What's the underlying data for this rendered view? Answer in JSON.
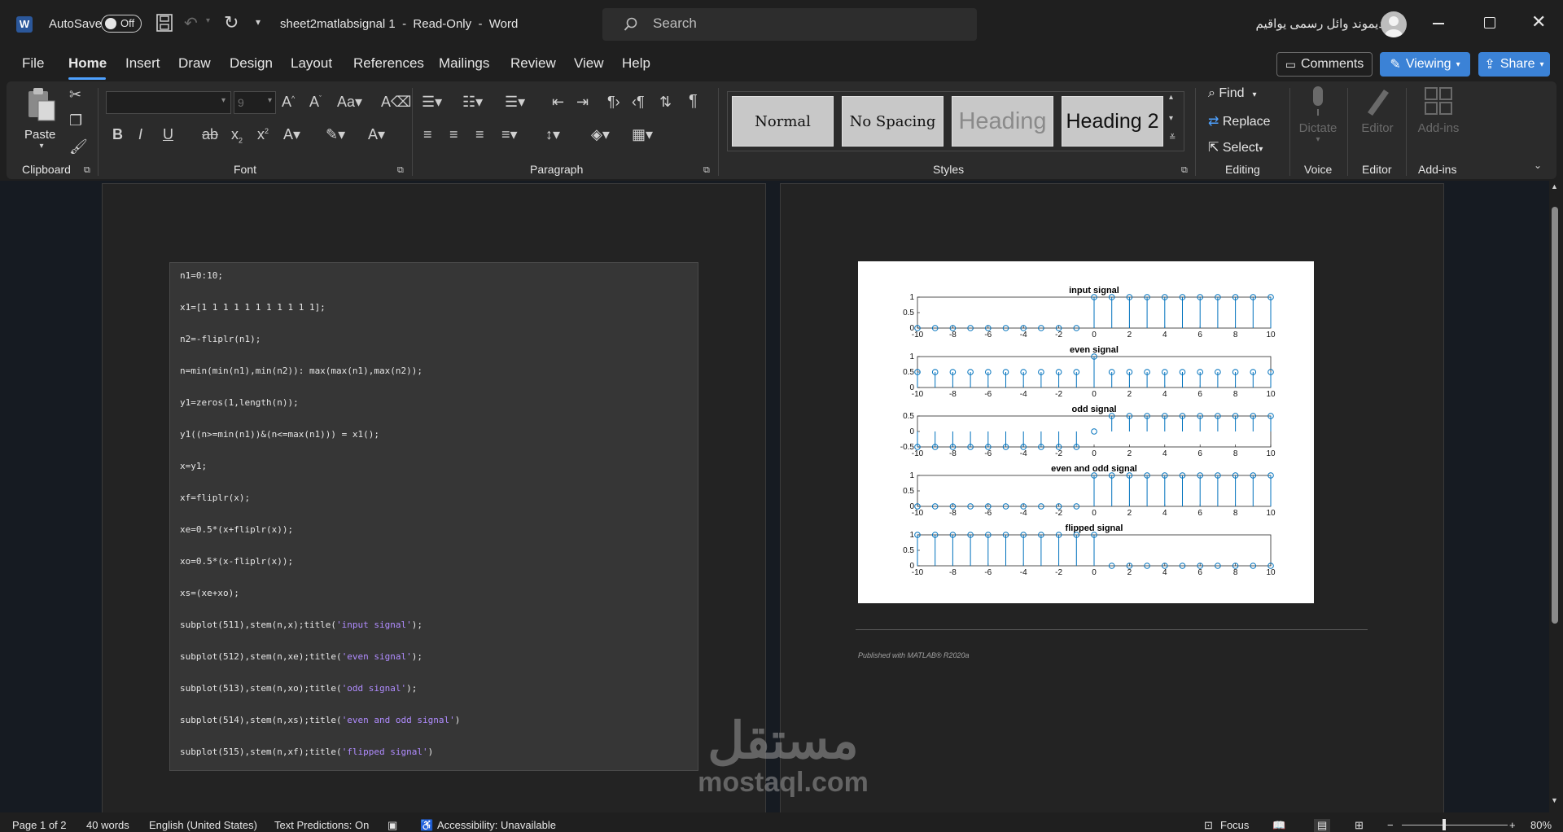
{
  "titlebar": {
    "autosave_label": "AutoSave",
    "autosave_state": "Off",
    "doc_title": "sheet2matlabsignal 1  -  Read-Only  -  Word",
    "search_placeholder": "Search",
    "user_name": "ديموند وائل رسمى يواقيم"
  },
  "menu": {
    "items": [
      "File",
      "Home",
      "Insert",
      "Draw",
      "Design",
      "Layout",
      "References",
      "Mailings",
      "Review",
      "View",
      "Help"
    ],
    "active": "Home",
    "comments_label": "Comments",
    "viewing_label": "Viewing",
    "share_label": "Share"
  },
  "ribbon": {
    "clipboard": {
      "paste_label": "Paste",
      "group_label": "Clipboard"
    },
    "font": {
      "font_name": "",
      "font_size": "9",
      "group_label": "Font"
    },
    "paragraph": {
      "group_label": "Paragraph"
    },
    "styles": {
      "group_label": "Styles",
      "items": [
        "Normal",
        "No Spacing",
        "Heading",
        "Heading 2"
      ]
    },
    "editing": {
      "find_label": "Find",
      "replace_label": "Replace",
      "select_label": "Select",
      "group_label": "Editing"
    },
    "voice": {
      "dictate_label": "Dictate",
      "group_label": "Voice"
    },
    "editor": {
      "editor_label": "Editor",
      "group_label": "Editor"
    },
    "addins": {
      "addins_label": "Add-ins",
      "group_label": "Add-ins"
    }
  },
  "document": {
    "code_lines": [
      [
        {
          "t": "n1=0:10;"
        }
      ],
      [
        {
          "t": "x1=[1 1 1 1 1 1 1 1 1 1 1];"
        }
      ],
      [
        {
          "t": "n2=-fliplr(n1);"
        }
      ],
      [
        {
          "t": "n=min(min(n1),min(n2)): max(max(n1),max(n2));"
        }
      ],
      [
        {
          "t": "y1=zeros(1,length(n));"
        }
      ],
      [
        {
          "t": "y1((n>=min(n1))&(n<=max(n1))) = x1();"
        }
      ],
      [
        {
          "t": "x=y1;"
        }
      ],
      [
        {
          "t": "xf=fliplr(x);"
        }
      ],
      [
        {
          "t": "xe=0.5*(x+fliplr(x));"
        }
      ],
      [
        {
          "t": "xo=0.5*(x-fliplr(x));"
        }
      ],
      [
        {
          "t": "xs=(xe+xo);"
        }
      ],
      [
        {
          "t": "subplot(511),stem(n,x);title("
        },
        {
          "t": "'input signal'",
          "s": true
        },
        {
          "t": ");"
        }
      ],
      [
        {
          "t": "subplot(512),stem(n,xe);title("
        },
        {
          "t": "'even signal'",
          "s": true
        },
        {
          "t": ");"
        }
      ],
      [
        {
          "t": "subplot(513),stem(n,xo);title("
        },
        {
          "t": "'odd signal'",
          "s": true
        },
        {
          "t": ");"
        }
      ],
      [
        {
          "t": "subplot(514),stem(n,xs);title("
        },
        {
          "t": "'even and odd signal'",
          "s": true
        },
        {
          "t": ")"
        }
      ],
      [
        {
          "t": "subplot(515),stem(n,xf);title("
        },
        {
          "t": "'flipped signal'",
          "s": true
        },
        {
          "t": ")"
        }
      ]
    ],
    "published_note": "Published with MATLAB® R2020a",
    "watermark_text": "mostaql.com",
    "watermark_arabic": "مستقل"
  },
  "chart_data": {
    "type": "scatter",
    "subtype": "stem",
    "x": [
      -10,
      -9,
      -8,
      -7,
      -6,
      -5,
      -4,
      -3,
      -2,
      -1,
      0,
      1,
      2,
      3,
      4,
      5,
      6,
      7,
      8,
      9,
      10
    ],
    "xticks": [
      -10,
      -8,
      -6,
      -4,
      -2,
      0,
      2,
      4,
      6,
      8,
      10
    ],
    "xlim": [
      -10,
      10
    ],
    "subplots": [
      {
        "title": "input signal",
        "ylim": [
          0,
          1
        ],
        "yticks": [
          "0",
          "0.5",
          "1"
        ],
        "values": [
          0,
          0,
          0,
          0,
          0,
          0,
          0,
          0,
          0,
          0,
          1,
          1,
          1,
          1,
          1,
          1,
          1,
          1,
          1,
          1,
          1
        ]
      },
      {
        "title": "even signal",
        "ylim": [
          0,
          1
        ],
        "yticks": [
          "0",
          "0.5",
          "1"
        ],
        "values": [
          0.5,
          0.5,
          0.5,
          0.5,
          0.5,
          0.5,
          0.5,
          0.5,
          0.5,
          0.5,
          1,
          0.5,
          0.5,
          0.5,
          0.5,
          0.5,
          0.5,
          0.5,
          0.5,
          0.5,
          0.5
        ]
      },
      {
        "title": "odd signal",
        "ylim": [
          -0.5,
          0.5
        ],
        "yticks": [
          "-0.5",
          "0",
          "0.5"
        ],
        "values": [
          -0.5,
          -0.5,
          -0.5,
          -0.5,
          -0.5,
          -0.5,
          -0.5,
          -0.5,
          -0.5,
          -0.5,
          0,
          0.5,
          0.5,
          0.5,
          0.5,
          0.5,
          0.5,
          0.5,
          0.5,
          0.5,
          0.5
        ]
      },
      {
        "title": "even and odd signal",
        "ylim": [
          0,
          1
        ],
        "yticks": [
          "0",
          "0.5",
          "1"
        ],
        "values": [
          0,
          0,
          0,
          0,
          0,
          0,
          0,
          0,
          0,
          0,
          1,
          1,
          1,
          1,
          1,
          1,
          1,
          1,
          1,
          1,
          1
        ]
      },
      {
        "title": "flipped signal",
        "ylim": [
          0,
          1
        ],
        "yticks": [
          "0",
          "0.5",
          "1"
        ],
        "values": [
          1,
          1,
          1,
          1,
          1,
          1,
          1,
          1,
          1,
          1,
          1,
          0,
          0,
          0,
          0,
          0,
          0,
          0,
          0,
          0,
          0
        ]
      }
    ],
    "stem_color": "#0072bd"
  },
  "statusbar": {
    "page": "Page 1 of 2",
    "words": "40 words",
    "language": "English (United States)",
    "text_predictions": "Text Predictions: On",
    "accessibility": "Accessibility: Unavailable",
    "focus": "Focus",
    "zoom": "80%",
    "zoom_level": 0.8
  }
}
